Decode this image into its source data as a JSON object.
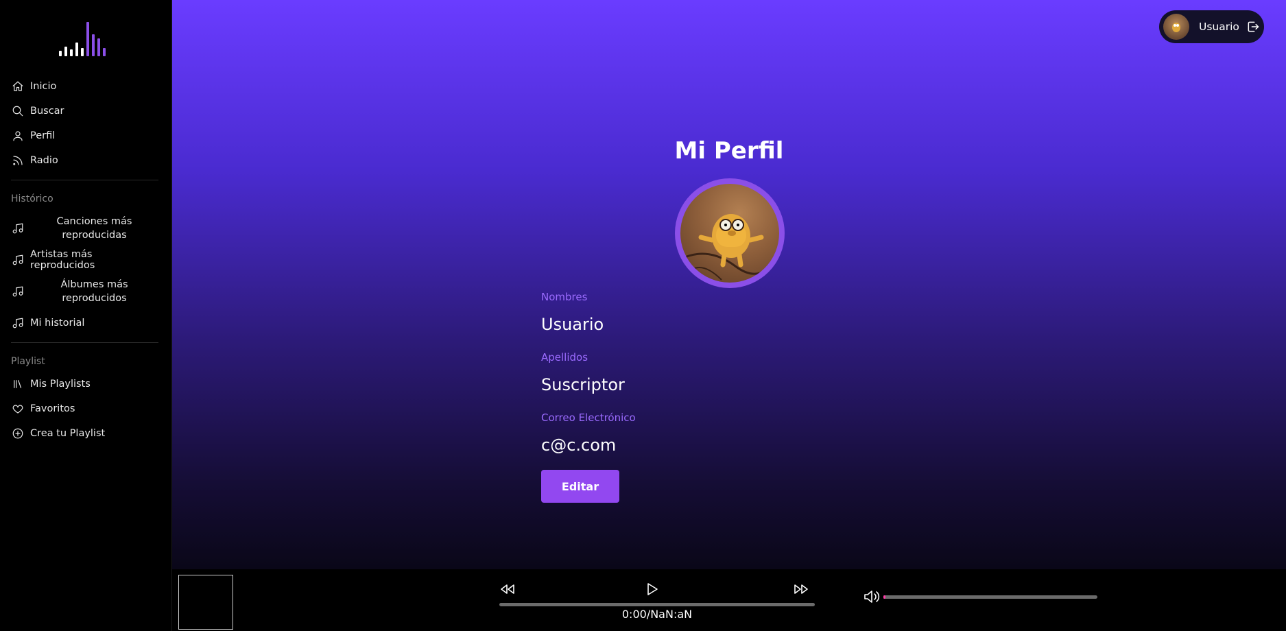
{
  "sidebar": {
    "nav": [
      {
        "label": "Inicio",
        "icon": "home-icon"
      },
      {
        "label": "Buscar",
        "icon": "search-icon"
      },
      {
        "label": "Perfil",
        "icon": "user-icon"
      },
      {
        "label": "Radio",
        "icon": "rss-icon"
      }
    ],
    "historico_title": "Histórico",
    "historico": [
      {
        "label": "Canciones más reproducidas",
        "icon": "music-note-icon"
      },
      {
        "label": "Artistas más reproducidos",
        "icon": "music-note-icon"
      },
      {
        "label": "Álbumes más reproducidos",
        "icon": "music-note-icon"
      },
      {
        "label": "Mi historial",
        "icon": "music-note-icon"
      }
    ],
    "playlist_title": "Playlist",
    "playlist": [
      {
        "label": "Mis Playlists",
        "icon": "library-icon"
      },
      {
        "label": "Favoritos",
        "icon": "heart-icon"
      },
      {
        "label": "Crea tu Playlist",
        "icon": "plus-circle-icon"
      }
    ]
  },
  "header": {
    "user_name": "Usuario"
  },
  "profile": {
    "title": "Mi Perfil",
    "fields": [
      {
        "label": "Nombres",
        "value": "Usuario"
      },
      {
        "label": "Apellidos",
        "value": "Suscriptor"
      },
      {
        "label": "Correo Electrónico",
        "value": "c@c.com"
      }
    ],
    "edit_label": "Editar"
  },
  "player": {
    "time": "0:00/NaN:aN",
    "progress": 0,
    "volume": 0.01
  },
  "colors": {
    "accent": "#9248f0",
    "label": "#9b6bff",
    "gradient_top": "#6a3cff",
    "volume_fill": "#ff3aa8"
  }
}
